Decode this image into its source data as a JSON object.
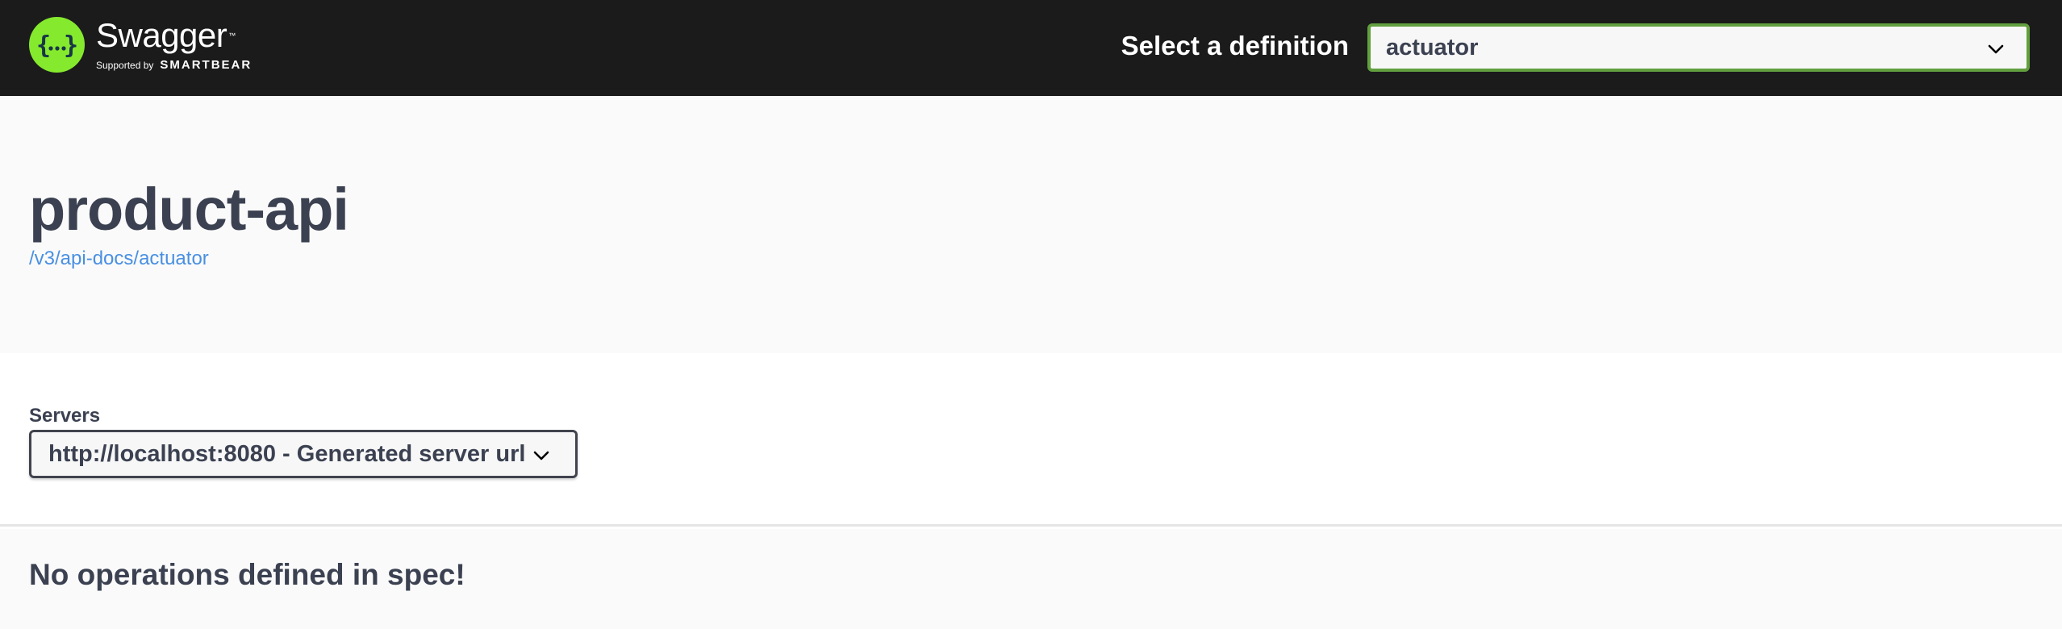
{
  "topbar": {
    "logo": {
      "name": "Swagger",
      "tm": "™",
      "supported_by": "Supported by",
      "brand": "SMARTBEAR"
    },
    "definition_label": "Select a definition",
    "definition_selected": "actuator"
  },
  "info": {
    "title": "product-api",
    "spec_url": "/v3/api-docs/actuator"
  },
  "servers": {
    "label": "Servers",
    "selected": "http://localhost:8080 - Generated server url"
  },
  "operations": {
    "empty_message": "No operations defined in spec!"
  },
  "colors": {
    "topbar_bg": "#1b1b1b",
    "logo_green": "#85ea2d",
    "select_border_active": "#62a03f",
    "link": "#4990e2",
    "text": "#3b4151"
  },
  "icons": {
    "logo": "swagger-logo-icon",
    "dropdown": "chevron-down-icon"
  }
}
